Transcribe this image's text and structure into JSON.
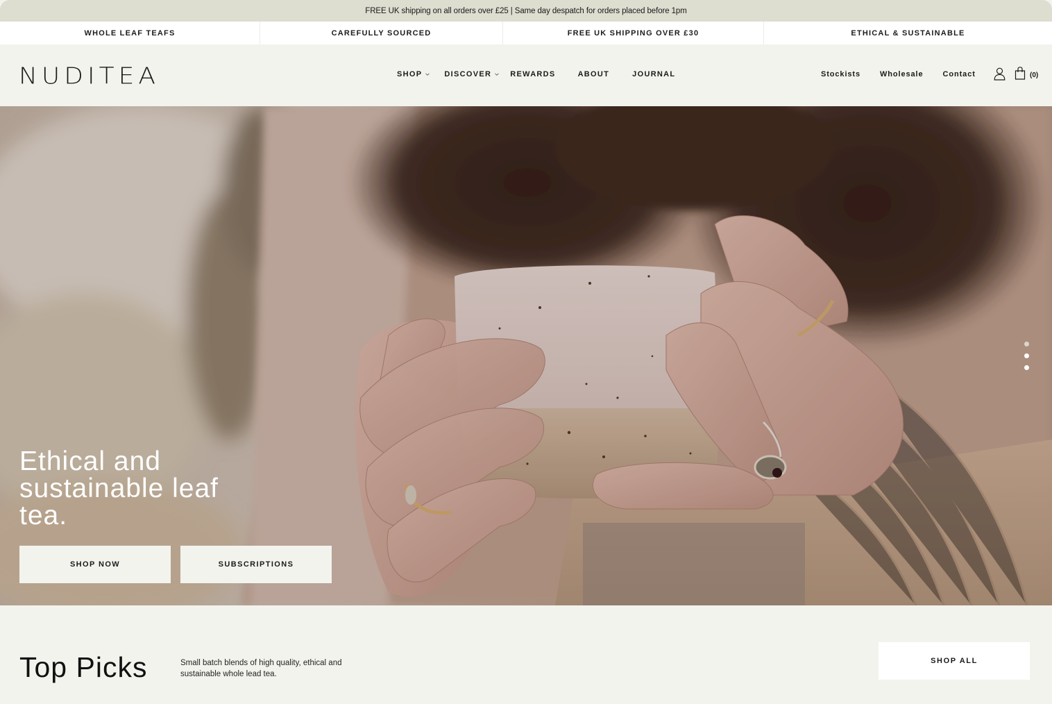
{
  "announcement": "FREE UK shipping on all orders over £25 | Same day despatch for orders placed before 1pm",
  "usp_bar": [
    "WHOLE LEAF TEAFS",
    "CAREFULLY SOURCED",
    "FREE UK SHIPPING OVER £30",
    "ETHICAL & SUSTAINABLE"
  ],
  "header": {
    "logo": "NUDITEA",
    "main_nav": [
      {
        "label": "SHOP",
        "has_dropdown": true
      },
      {
        "label": "DISCOVER",
        "has_dropdown": true
      },
      {
        "label": "REWARDS",
        "has_dropdown": false
      },
      {
        "label": "ABOUT",
        "has_dropdown": false
      },
      {
        "label": "JOURNAL",
        "has_dropdown": false
      }
    ],
    "secondary_nav": [
      "Stockists",
      "Wholesale",
      "Contact"
    ],
    "account_icon": "user-icon",
    "cart_icon": "shopping-bag-icon",
    "cart_count": "(0)"
  },
  "hero": {
    "title": "Ethical and sustainable leaf tea.",
    "primary_button": "SHOP NOW",
    "secondary_button": "SUBSCRIPTIONS",
    "slides": {
      "count": 3,
      "active_index": 0
    },
    "image_description": "Person in a knit sweater holding a speckled ceramic mug with both hands"
  },
  "top_picks": {
    "title": "Top Picks",
    "description": "Small batch blends of high quality, ethical and sustainable whole lead tea.",
    "button": "SHOP ALL"
  },
  "colors": {
    "announcement_bg": "#ddddd0",
    "page_bg": "#f3f3ee",
    "button_bg": "#f3f3ee",
    "text": "#1a1a1a"
  }
}
